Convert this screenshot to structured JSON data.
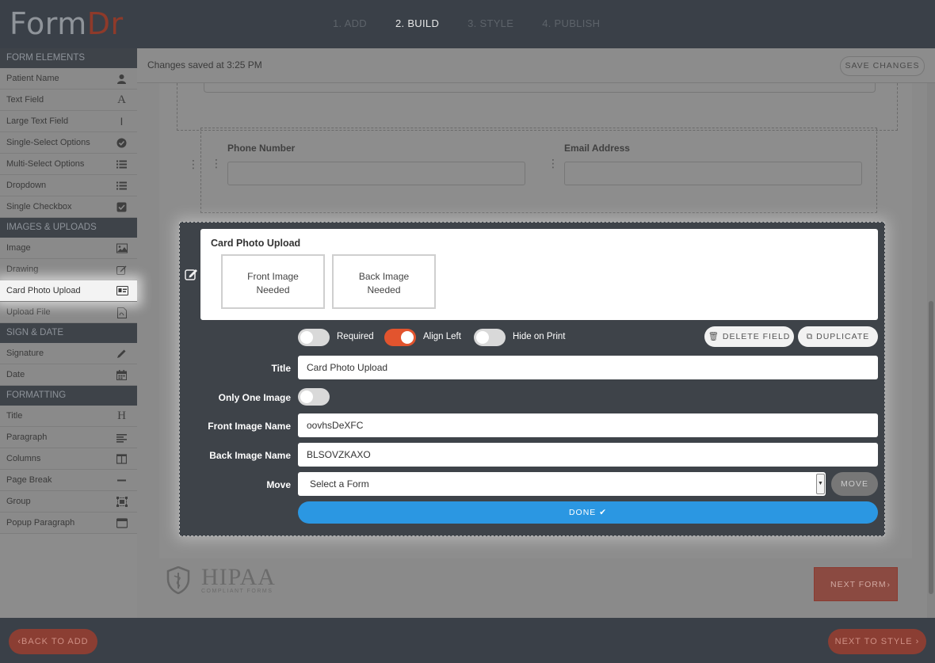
{
  "app": {
    "logo_form": "Form",
    "logo_dr": "Dr"
  },
  "steps": [
    "1. ADD",
    "2. BUILD",
    "3. STYLE",
    "4. PUBLISH"
  ],
  "active_step": "2. BUILD",
  "sidebar": {
    "sections": [
      {
        "title": "FORM ELEMENTS",
        "items": [
          {
            "label": "Patient Name",
            "icon": "user-icon"
          },
          {
            "label": "Text Field",
            "icon": "text-icon"
          },
          {
            "label": "Large Text Field",
            "icon": "text-cursor-icon"
          },
          {
            "label": "Single-Select Options",
            "icon": "check-circle-icon"
          },
          {
            "label": "Multi-Select Options",
            "icon": "list-icon"
          },
          {
            "label": "Dropdown",
            "icon": "list-icon"
          },
          {
            "label": "Single Checkbox",
            "icon": "checkbox-icon"
          }
        ]
      },
      {
        "title": "IMAGES & UPLOADS",
        "items": [
          {
            "label": "Image",
            "icon": "image-icon"
          },
          {
            "label": "Drawing",
            "icon": "edit-icon"
          },
          {
            "label": "Card Photo Upload",
            "icon": "id-card-icon"
          },
          {
            "label": "Upload File",
            "icon": "file-icon"
          }
        ]
      },
      {
        "title": "SIGN & DATE",
        "items": [
          {
            "label": "Signature",
            "icon": "pen-icon"
          },
          {
            "label": "Date",
            "icon": "calendar-icon"
          }
        ]
      },
      {
        "title": "FORMATTING",
        "items": [
          {
            "label": "Title",
            "icon": "heading-icon"
          },
          {
            "label": "Paragraph",
            "icon": "align-left-icon"
          },
          {
            "label": "Columns",
            "icon": "columns-icon"
          },
          {
            "label": "Page Break",
            "icon": "minus-icon"
          },
          {
            "label": "Group",
            "icon": "group-icon"
          },
          {
            "label": "Popup Paragraph",
            "icon": "window-icon"
          }
        ]
      }
    ]
  },
  "savebar": {
    "status": "Changes saved at 3:25 PM",
    "save_label": "SAVE CHANGES"
  },
  "form_rows": {
    "phone_label": "Phone Number",
    "email_label": "Email Address"
  },
  "editor": {
    "preview_title": "Card Photo Upload",
    "front_box": [
      "Front Image",
      "Needed"
    ],
    "back_box": [
      "Back Image",
      "Needed"
    ],
    "toggles": {
      "required": {
        "label": "Required",
        "on": false
      },
      "align_left": {
        "label": "Align Left",
        "on": true
      },
      "hide_on_print": {
        "label": "Hide on Print",
        "on": false
      }
    },
    "delete_label": "DELETE FIELD",
    "duplicate_label": "DUPLICATE",
    "title_label": "Title",
    "title_value": "Card Photo Upload",
    "only_one_label": "Only One Image",
    "only_one_on": false,
    "front_name_label": "Front Image Name",
    "front_name_value": "oovhsDeXFC",
    "back_name_label": "Back Image Name",
    "back_name_value": "BLSOVZKAXO",
    "move_label": "Move",
    "move_select": "Select a Form",
    "move_button": "MOVE",
    "done_label": "DONE"
  },
  "hipaa": {
    "big": "HIPAA",
    "small": "COMPLIANT FORMS"
  },
  "next_form_label": "NEXT FORM",
  "bottom": {
    "back_label": "BACK TO ADD",
    "next_label": "NEXT TO STYLE"
  },
  "colors": {
    "accent": "#e2542e",
    "done": "#2b97e2",
    "brand": "#8b3e33"
  }
}
